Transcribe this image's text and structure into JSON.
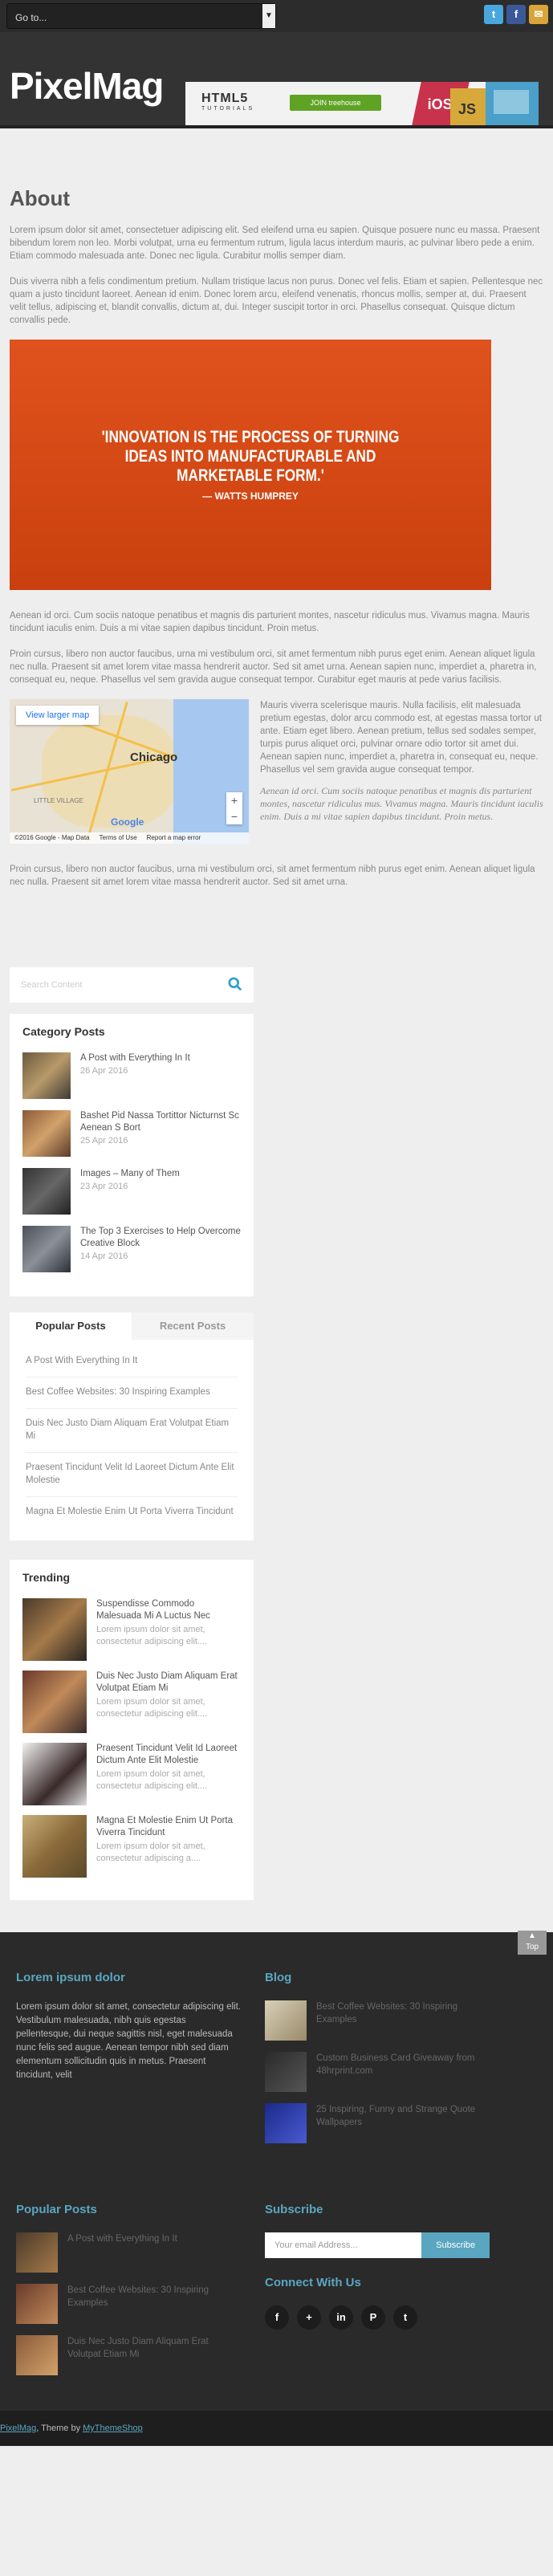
{
  "topbar": {
    "goto_label": "Go to...",
    "social": [
      {
        "name": "twitter",
        "glyph": "t",
        "color": "#4aa7dd"
      },
      {
        "name": "facebook",
        "glyph": "f",
        "color": "#3b5998"
      },
      {
        "name": "email",
        "glyph": "✉",
        "color": "#d9a53a"
      }
    ]
  },
  "header": {
    "logo": "PixelMag",
    "banner": {
      "html5": "HTML5",
      "tutorials": "TUTORIALS",
      "join": "JOIN treehouse",
      "ios": "iOS",
      "js": "JS"
    }
  },
  "article": {
    "title": "About",
    "p1": "Lorem ipsum dolor sit amet, consectetuer adipiscing elit. Sed eleifend urna eu sapien. Quisque posuere nunc eu massa. Praesent bibendum lorem non leo. Morbi volutpat, urna eu fermentum rutrum, ligula lacus interdum mauris, ac pulvinar libero pede a enim. Etiam commodo malesuada ante. Donec nec ligula. Curabitur mollis semper diam.",
    "p2": "Duis viverra nibh a felis condimentum pretium. Nullam tristique lacus non purus. Donec vel felis. Etiam et sapien. Pellentesque nec quam a justo tincidunt laoreet. Aenean id enim. Donec lorem arcu, eleifend venenatis, rhoncus mollis, semper at, dui. Praesent velit tellus, adipiscing et, blandit convallis, dictum at, dui. Integer suscipit tortor in orci. Phasellus consequat. Quisque dictum convallis pede.",
    "quote_text": "'INNOVATION IS THE PROCESS OF TURNING IDEAS INTO MANUFACTURABLE AND MARKETABLE FORM.'",
    "quote_author": "— WATTS HUMPREY",
    "p3": "Aenean id orci. Cum sociis natoque penatibus et magnis dis parturient montes, nascetur ridiculus mus. Vivamus magna. Mauris tincidunt iaculis enim. Duis a mi vitae sapien dapibus tincidunt. Proin metus.",
    "p4": "Proin cursus, libero non auctor faucibus, urna mi vestibulum orci, sit amet fermentum nibh purus eget enim. Aenean aliquet ligula nec nulla. Praesent sit amet lorem vitae massa hendrerit auctor. Sed sit amet urna. Aenean sapien nunc, imperdiet a, pharetra in, consequat eu, neque. Phasellus vel sem gravida augue consequat tempor. Curabitur eget mauris at pede varius facilisis.",
    "map": {
      "button": "View larger map",
      "city": "Chicago",
      "neighborhood": "LITTLE VILLAGE",
      "logo": "Google",
      "footer1": "©2016 Google - Map Data",
      "footer2": "Terms of Use",
      "footer3": "Report a map error"
    },
    "p5": "Mauris viverra scelerisque mauris. Nulla facilisis, elit malesuada pretium egestas, dolor arcu commodo est, at egestas massa tortor ut ante. Etiam eget libero. Aenean pretium, tellus sed sodales semper, turpis purus aliquet orci, pulvinar ornare odio tortor sit amet dui. Aenean sapien nunc, imperdiet a, pharetra in, consequat eu, neque. Phasellus vel sem gravida augue consequat tempor.",
    "quote2": "Aenean id orci. Cum sociis natoque penatibus et magnis dis parturient montes, nascetur ridiculus mus. Vivamus magna. Mauris tincidunt iaculis enim. Duis a mi vitae sapien dapibus tincidunt. Proin metus.",
    "p6": "Proin cursus, libero non auctor faucibus, urna mi vestibulum orci, sit amet fermentum nibh purus eget enim. Aenean aliquet ligula nec nulla. Praesent sit amet lorem vitae massa hendrerit auctor. Sed sit amet urna."
  },
  "search": {
    "placeholder": "Search Content"
  },
  "category_posts": {
    "title": "Category Posts",
    "items": [
      {
        "title": "A Post with Everything In It",
        "date": "26 Apr 2016"
      },
      {
        "title": "Bashet Pid Nassa Tortittor Nicturnst Sc Aenean S Bort",
        "date": "25 Apr 2016"
      },
      {
        "title": "Images – Many of Them",
        "date": "23 Apr 2016"
      },
      {
        "title": "The Top 3 Exercises to Help Overcome Creative Block",
        "date": "14 Apr 2016"
      }
    ]
  },
  "tabs": {
    "popular": "Popular Posts",
    "recent": "Recent Posts",
    "items": [
      "A Post With Everything In It",
      "Best Coffee Websites: 30 Inspiring Examples",
      "Duis Nec Justo Diam Aliquam Erat Volutpat Etiam Mi",
      "Praesent Tincidunt Velit Id Laoreet Dictum Ante Elit Molestie",
      "Magna Et Molestie Enim Ut Porta Viverra Tincidunt"
    ]
  },
  "trending": {
    "title": "Trending",
    "items": [
      {
        "title": "Suspendisse Commodo Malesuada Mi A Luctus Nec",
        "excerpt": "Lorem ipsum dolor sit amet, consectetur adipiscing elit...."
      },
      {
        "title": "Duis Nec Justo Diam Aliquam Erat Volutpat Etiam Mi",
        "excerpt": "Lorem ipsum dolor sit amet, consectetur adipiscing elit...."
      },
      {
        "title": "Praesent Tincidunt Velit Id Laoreet Dictum Ante Elit Molestie",
        "excerpt": "Lorem ipsum dolor sit amet, consectetur adipiscing elit...."
      },
      {
        "title": "Magna Et Molestie Enim Ut Porta Viverra Tincidunt",
        "excerpt": "Lorem ipsum dolor sit amet, consectetur adipiscing a...."
      }
    ]
  },
  "footer": {
    "top": "Top",
    "about_title": "Lorem ipsum dolor",
    "about_text": "Lorem ipsum dolor sit amet, consectetur adipiscing elit. Vestibulum malesuada, nibh quis egestas pellentesque, dui neque sagittis nisl, eget malesuada nunc felis sed augue. Aenean tempor nibh sed diam elementum sollicitudin quis in metus. Praesent tincidunt, velit",
    "blog_title": "Blog",
    "blog_items": [
      "Best Coffee Websites: 30 Inspiring Examples",
      "Custom Business Card Giveaway from 48hrprint.com",
      "25 Inspiring, Funny and Strange Quote Wallpapers"
    ],
    "popular_title": "Popular Posts",
    "popular_items": [
      "A Post with Everything In It",
      "Best Coffee Websites: 30 Inspiring Examples",
      "Duis Nec Justo Diam Aliquam Erat Volutpat Etiam Mi"
    ],
    "subscribe_title": "Subscribe",
    "email_placeholder": "Your email Address...",
    "subscribe_button": "Subscribe",
    "connect_title": "Connect With Us",
    "connect_icons": [
      "f",
      "+",
      "in",
      "P",
      "t"
    ]
  },
  "bottombar": {
    "site": "PixelMag",
    "theme_prefix": ", Theme by ",
    "theme_link": "MyThemeShop"
  }
}
